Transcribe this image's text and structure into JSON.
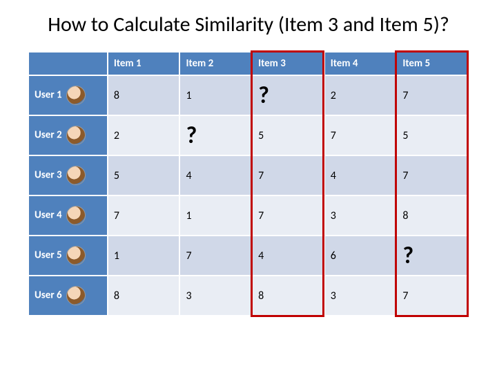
{
  "title": "How to Calculate Similarity (Item 3 and Item 5)?",
  "columns": [
    "Item 1",
    "Item 2",
    "Item 3",
    "Item 4",
    "Item 5"
  ],
  "rows": [
    {
      "label": "User 1",
      "cells": [
        "8",
        "1",
        "?",
        "2",
        "7"
      ]
    },
    {
      "label": "User 2",
      "cells": [
        "2",
        "?",
        "5",
        "7",
        "5"
      ]
    },
    {
      "label": "User 3",
      "cells": [
        "5",
        "4",
        "7",
        "4",
        "7"
      ]
    },
    {
      "label": "User 4",
      "cells": [
        "7",
        "1",
        "7",
        "3",
        "8"
      ]
    },
    {
      "label": "User 5",
      "cells": [
        "1",
        "7",
        "4",
        "6",
        "?"
      ]
    },
    {
      "label": "User 6",
      "cells": [
        "8",
        "3",
        "8",
        "3",
        "7"
      ]
    }
  ],
  "highlighted_columns": [
    "Item 3",
    "Item 5"
  ],
  "chart_data": {
    "type": "table",
    "title": "How to Calculate Similarity (Item 3 and Item 5)?",
    "columns": [
      "Item 1",
      "Item 2",
      "Item 3",
      "Item 4",
      "Item 5"
    ],
    "rows": [
      "User 1",
      "User 2",
      "User 3",
      "User 4",
      "User 5",
      "User 6"
    ],
    "values": [
      [
        8,
        1,
        null,
        2,
        7
      ],
      [
        2,
        null,
        5,
        7,
        5
      ],
      [
        5,
        4,
        7,
        4,
        7
      ],
      [
        7,
        1,
        7,
        3,
        8
      ],
      [
        1,
        7,
        4,
        6,
        null
      ],
      [
        8,
        3,
        8,
        3,
        7
      ]
    ],
    "missing_marker": "?",
    "highlighted_columns": [
      "Item 3",
      "Item 5"
    ]
  }
}
